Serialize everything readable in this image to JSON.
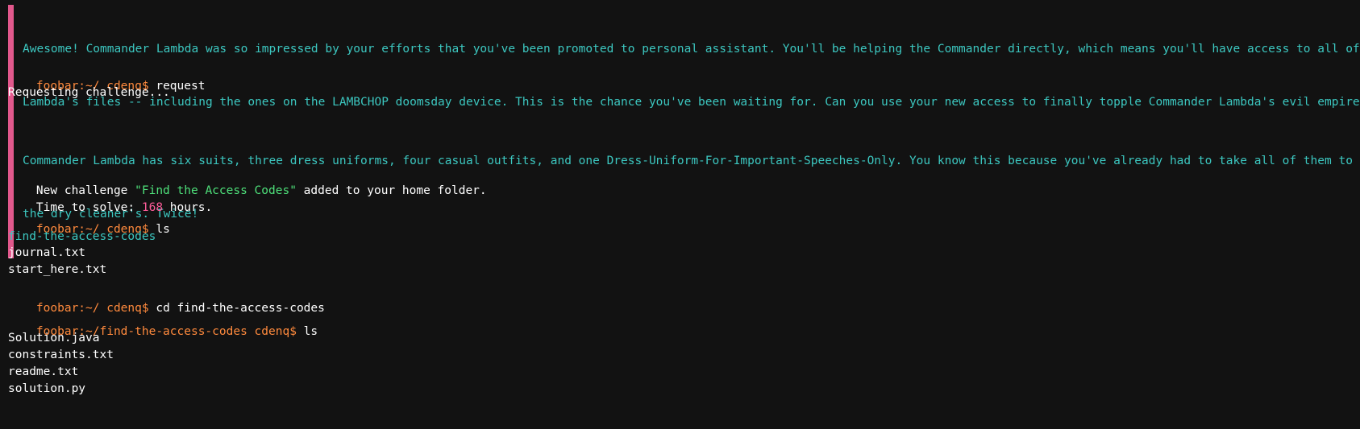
{
  "colors": {
    "background": "#121212",
    "message_text": "#3cc7c0",
    "message_bar": "#e2588c",
    "prompt": "#ff8a3d",
    "challenge_name": "#4ee07a",
    "hours": "#ff5c9a",
    "directory": "#3cc7c0"
  },
  "messages": [
    {
      "line1": "Awesome! Commander Lambda was so impressed by your efforts that you've been promoted to personal assistant. You'll be helping the Commander directly, which means you'll have access to all of",
      "line2": "Lambda's files -- including the ones on the LAMBCHOP doomsday device. This is the chance you've been waiting for. Can you use your new access to finally topple Commander Lambda's evil empire?"
    },
    {
      "line1": "Commander Lambda has six suits, three dress uniforms, four casual outfits, and one Dress-Uniform-For-Important-Speeches-Only. You know this because you've already had to take all of them to",
      "line2": "the dry cleaner's. Twice!"
    }
  ],
  "commands": [
    {
      "prompt": "foobar:~/ cdenq$",
      "command": "request"
    },
    {
      "prompt": "foobar:~/ cdenq$",
      "command": "ls"
    },
    {
      "prompt": "foobar:~/ cdenq$",
      "command": "cd find-the-access-codes"
    },
    {
      "prompt": "foobar:~/find-the-access-codes cdenq$",
      "command": "ls"
    }
  ],
  "request_output": "Requesting challenge...",
  "challenge": {
    "prefix": "New challenge ",
    "name": "\"Find the Access Codes\"",
    "suffix": " added to your home folder.",
    "time_prefix": "Time to solve: ",
    "hours": "168",
    "time_suffix": " hours."
  },
  "home_listing": {
    "directory": "find-the-access-codes",
    "files": [
      "journal.txt",
      "start_here.txt"
    ]
  },
  "challenge_listing": {
    "files": [
      "Solution.java",
      "constraints.txt",
      "readme.txt",
      "solution.py"
    ]
  }
}
